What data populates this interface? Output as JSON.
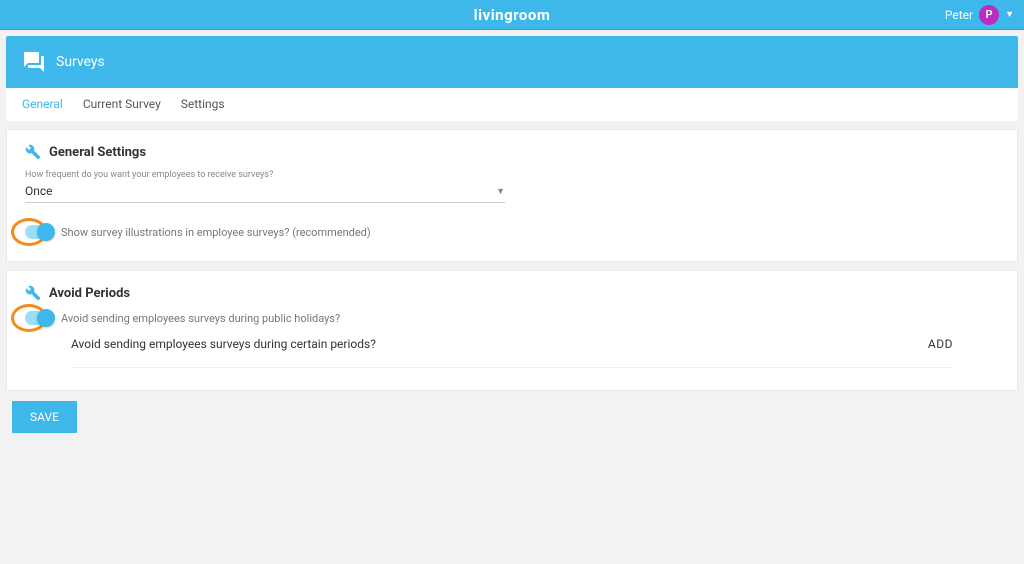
{
  "topbar": {
    "brand": "livingroom",
    "user_name": "Peter",
    "avatar_initial": "P"
  },
  "header": {
    "title": "Surveys"
  },
  "tabs": {
    "general": "General",
    "current": "Current Survey",
    "settings": "Settings"
  },
  "general_section": {
    "title": "General Settings",
    "frequency_label": "How frequent do you want your employees to receive surveys?",
    "frequency_value": "Once",
    "show_illustrations_label": "Show survey illustrations in employee surveys? (recommended)"
  },
  "avoid_section": {
    "title": "Avoid Periods",
    "public_holidays_label": "Avoid sending employees surveys during public holidays?",
    "certain_periods_label": "Avoid sending employees surveys during certain periods?",
    "add_label": "ADD"
  },
  "actions": {
    "save": "SAVE"
  }
}
